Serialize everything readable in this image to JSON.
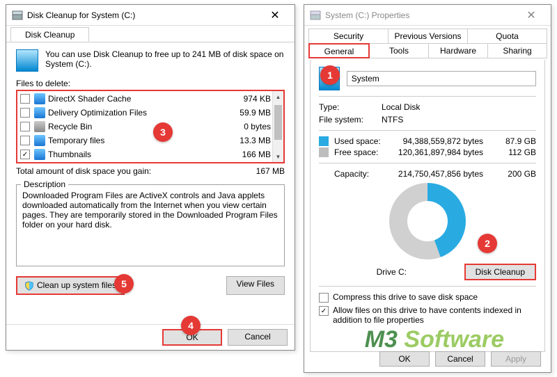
{
  "cleanup": {
    "title": "Disk Cleanup for System (C:)",
    "tab_label": "Disk Cleanup",
    "intro": "You can use Disk Cleanup to free up to 241 MB of disk space on System (C:).",
    "files_to_delete_label": "Files to delete:",
    "items": [
      {
        "name": "DirectX Shader Cache",
        "size": "974 KB",
        "checked": false,
        "icon": "drive"
      },
      {
        "name": "Delivery Optimization Files",
        "size": "59.9 MB",
        "checked": false,
        "icon": "drive"
      },
      {
        "name": "Recycle Bin",
        "size": "0 bytes",
        "checked": false,
        "icon": "bin"
      },
      {
        "name": "Temporary files",
        "size": "13.3 MB",
        "checked": false,
        "icon": "drive"
      },
      {
        "name": "Thumbnails",
        "size": "166 MB",
        "checked": true,
        "icon": "drive"
      }
    ],
    "total_label": "Total amount of disk space you gain:",
    "total_value": "167 MB",
    "description_group": "Description",
    "description_text": "Downloaded Program Files are ActiveX controls and Java applets downloaded automatically from the Internet when you view certain pages. They are temporarily stored in the Downloaded Program Files folder on your hard disk.",
    "cleanup_sys_btn": "Clean up system files",
    "view_files_btn": "View Files",
    "ok": "OK",
    "cancel": "Cancel"
  },
  "props": {
    "title": "System (C:) Properties",
    "tabs_row1": [
      "Security",
      "Previous Versions",
      "Quota"
    ],
    "tabs_row2": [
      "General",
      "Tools",
      "Hardware",
      "Sharing"
    ],
    "active_tab": "General",
    "name_value": "System",
    "type_label": "Type:",
    "type_value": "Local Disk",
    "fs_label": "File system:",
    "fs_value": "NTFS",
    "used_label": "Used space:",
    "used_bytes": "94,388,559,872 bytes",
    "used_human": "87.9 GB",
    "used_color": "#29abe2",
    "free_label": "Free space:",
    "free_bytes": "120,361,897,984 bytes",
    "free_human": "112 GB",
    "free_color": "#bdbdbd",
    "capacity_label": "Capacity:",
    "capacity_bytes": "214,750,457,856 bytes",
    "capacity_human": "200 GB",
    "drive_label": "Drive C:",
    "disk_cleanup_btn": "Disk Cleanup",
    "compress_label": "Compress this drive to save disk space",
    "compress_checked": false,
    "index_label": "Allow files on this drive to have contents indexed in addition to file properties",
    "index_checked": true,
    "ok": "OK",
    "cancel": "Cancel",
    "apply": "Apply"
  },
  "markers": {
    "1": "1",
    "2": "2",
    "3": "3",
    "4": "4",
    "5": "5"
  },
  "watermark": {
    "a": "M3",
    "b": "Software"
  }
}
